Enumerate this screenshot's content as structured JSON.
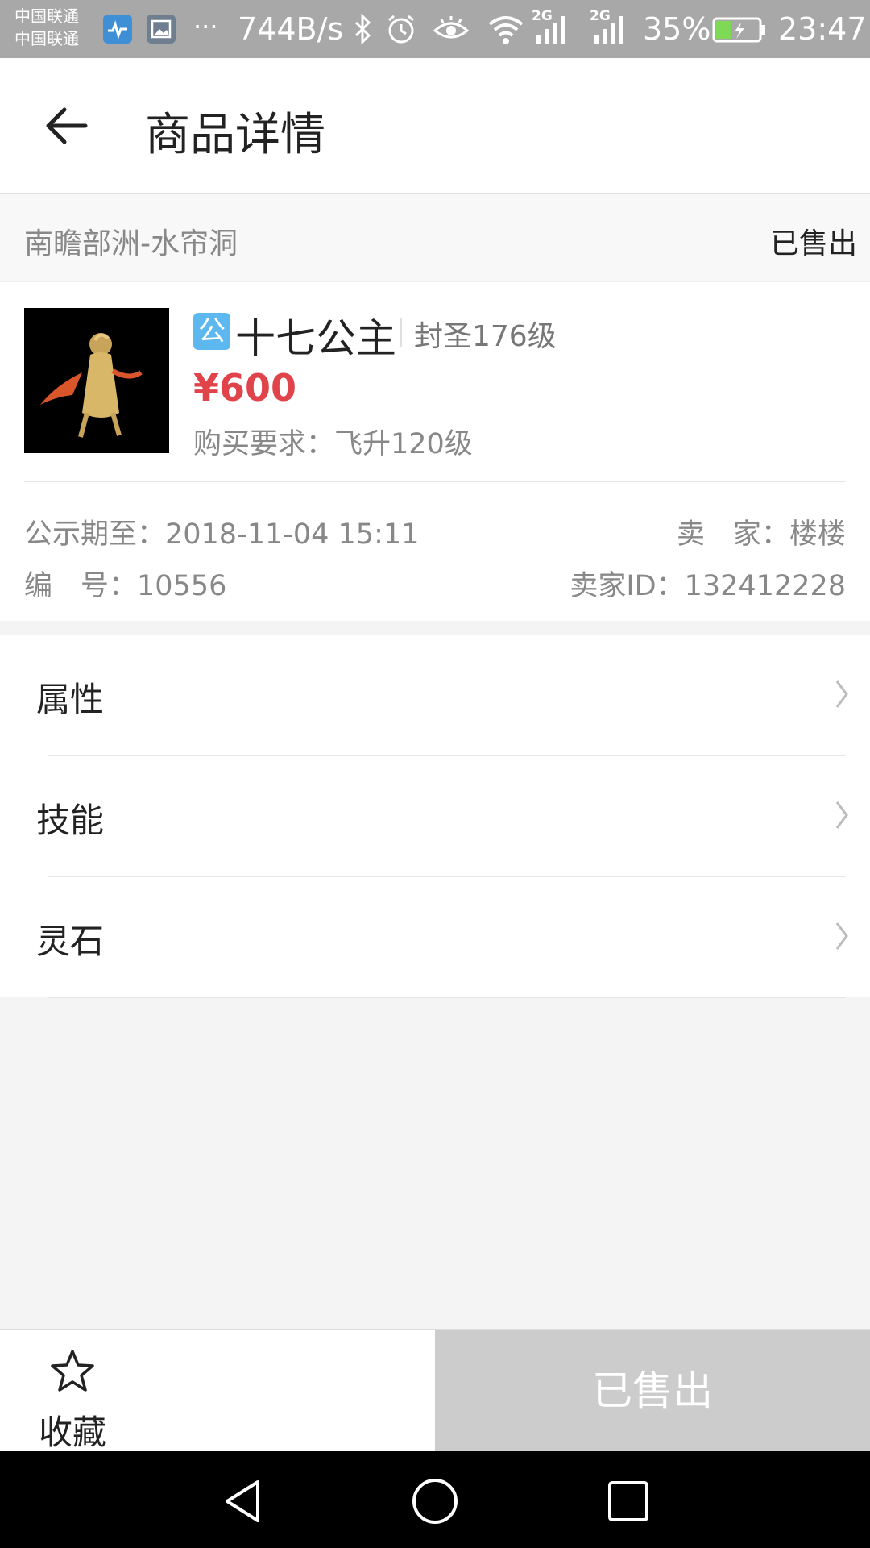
{
  "status_bar": {
    "carrier_1": "中国联通",
    "carrier_2": "中国联通",
    "overflow": "···",
    "net_speed": "744B/s",
    "network_1": "2G",
    "network_2": "2G",
    "battery": "35%",
    "time": "23:47",
    "icons": [
      "health-app-icon",
      "gallery-app-icon",
      "bluetooth-icon",
      "alarm-icon",
      "eye-icon",
      "wifi-icon",
      "signal-icon",
      "battery-icon"
    ]
  },
  "header": {
    "title": "商品详情",
    "back_icon": "arrow-left-icon"
  },
  "region": {
    "name": "南瞻部洲-水帘洞",
    "status": "已售出"
  },
  "product": {
    "badge": "公",
    "name": "十七公主",
    "level": "封圣176级",
    "price": "¥600",
    "requirement": "购买要求：飞升120级",
    "public_until": "公示期至：2018-11-04 15:11",
    "seller": "卖　家：楼楼",
    "serial": "编　号：10556",
    "seller_id": "卖家ID：132412228"
  },
  "sections": [
    {
      "label": "属性"
    },
    {
      "label": "技能"
    },
    {
      "label": "灵石"
    }
  ],
  "bottom_bar": {
    "favorite_label": "收藏",
    "sold_label": "已售出"
  },
  "colors": {
    "price": "#e0434a",
    "badge": "#5cb8ee",
    "sold_button": "#cccccc",
    "status_bar": "#a8a8a8"
  }
}
